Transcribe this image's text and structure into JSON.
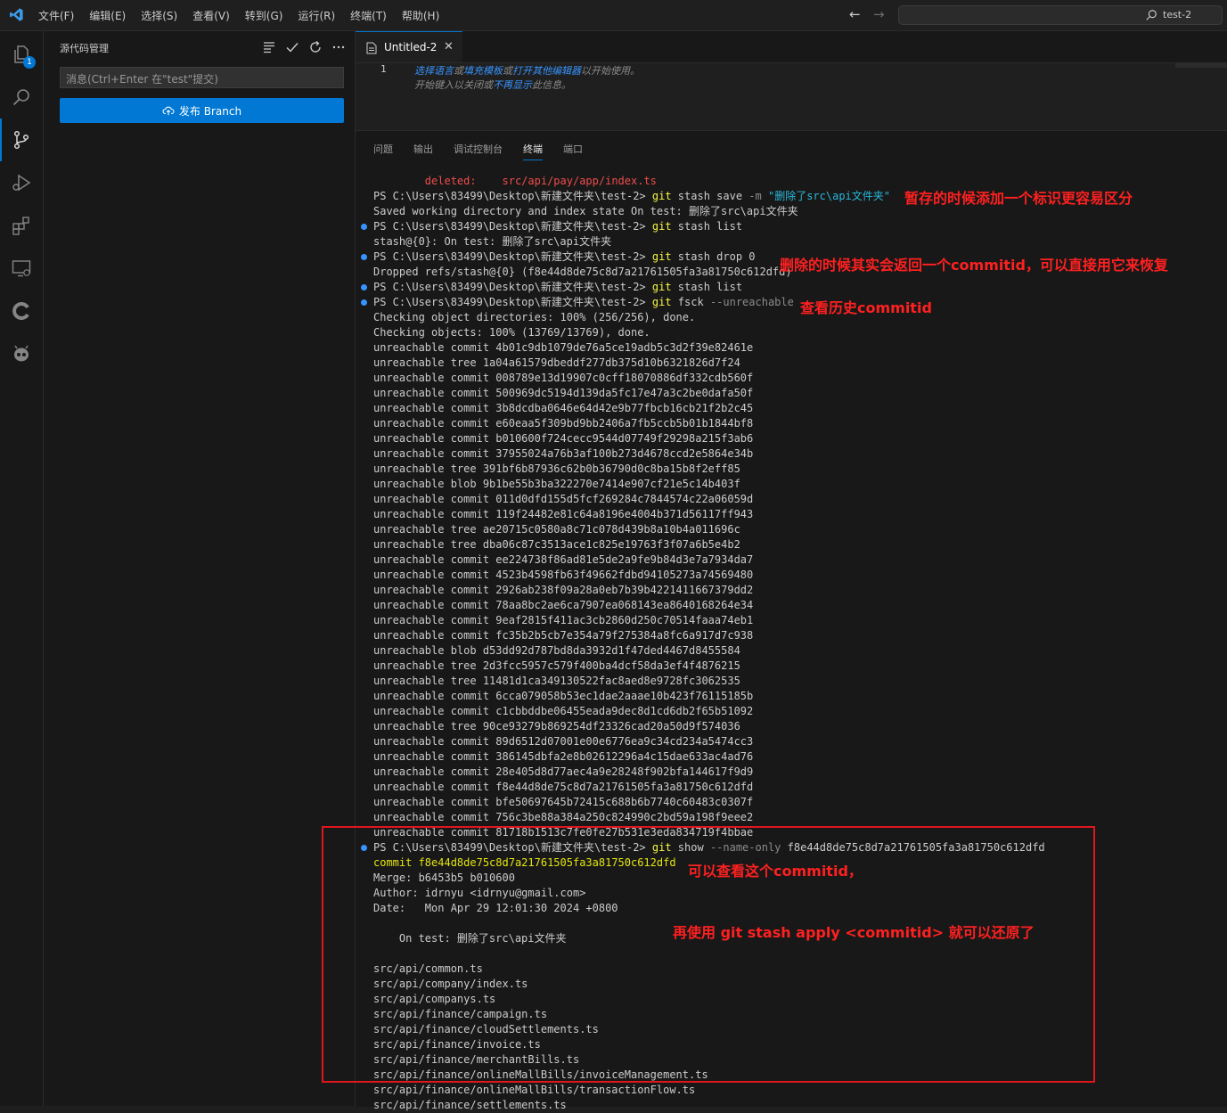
{
  "titlebar": {
    "menu": [
      "文件(F)",
      "编辑(E)",
      "选择(S)",
      "查看(V)",
      "转到(G)",
      "运行(R)",
      "终端(T)",
      "帮助(H)"
    ],
    "search_text": "test-2"
  },
  "activity": {
    "explorer_badge": "1"
  },
  "sidebar": {
    "title": "源代码管理",
    "message_placeholder": "消息(Ctrl+Enter 在\"test\"提交)",
    "publish_label": "发布 Branch"
  },
  "editor": {
    "tab_label": "Untitled-2",
    "line_number": "1",
    "hint1": {
      "a": "选择语言",
      "b": "或",
      "c": "填充模板",
      "d": "或",
      "e": "打开其他编辑器",
      "f": "以开始使用。"
    },
    "hint2": {
      "a": "开始键入以关闭或",
      "b": "不再显示",
      "c": "此信息。"
    }
  },
  "panel": {
    "tabs": [
      "问题",
      "输出",
      "调试控制台",
      "终端",
      "端口"
    ],
    "active_tab": "终端"
  },
  "terminal": {
    "deleted_label": "deleted:",
    "deleted_path": "src/api/pay/app/index.ts",
    "prompt": "PS C:\\Users\\83499\\Desktop\\新建文件夹\\test-2>",
    "cmd_stash_save_git": "git",
    "cmd_stash_save_rest": "stash save",
    "cmd_stash_save_flag": "-m",
    "cmd_stash_save_msg": "\"删除了src\\api文件夹\"",
    "saved_line": "Saved working directory and index state On test: 删除了src\\api文件夹",
    "cmd_list_git": "git",
    "cmd_list_rest": "stash list",
    "list_output": "stash@{0}: On test: 删除了src\\api文件夹",
    "cmd_drop_git": "git",
    "cmd_drop_rest": "stash drop 0",
    "dropped_line": "Dropped refs/stash@{0} (f8e44d8de75c8d7a21761505fa3a81750c612dfd)",
    "cmd_list2_git": "git",
    "cmd_list2_rest": "stash list",
    "cmd_fsck_git": "git",
    "cmd_fsck_rest": "fsck",
    "cmd_fsck_flag": "--unreachable",
    "check_dirs": "Checking object directories: 100% (256/256), done.",
    "check_objs": "Checking objects: 100% (13769/13769), done.",
    "unreachable": [
      "unreachable commit 4b01c9db1079de76a5ce19adb5c3d2f39e82461e",
      "unreachable tree 1a04a61579dbeddf277db375d10b6321826d7f24",
      "unreachable commit 008789e13d19907c0cff18070886df332cdb560f",
      "unreachable commit 500969dc5194d139da5fc17e47a3c2be0dafa50f",
      "unreachable commit 3b8dcdba0646e64d42e9b77fbcb16cb21f2b2c45",
      "unreachable commit e60eaa5f309bd9bb2406a7fb5ccb5b01b1844bf8",
      "unreachable commit b010600f724cecc9544d07749f29298a215f3ab6",
      "unreachable commit 37955024a76b3af100b273d4678ccd2e5864e34b",
      "unreachable tree 391bf6b87936c62b0b36790d0c8ba15b8f2eff85",
      "unreachable blob 9b1be55b3ba322270e7414e907cf21e5c14b403f",
      "unreachable commit 011d0dfd155d5fcf269284c7844574c22a06059d",
      "unreachable commit 119f24482e81c64a8196e4004b371d56117ff943",
      "unreachable tree ae20715c0580a8c71c078d439b8a10b4a011696c",
      "unreachable tree dba06c87c3513ace1c825e19763f3f07a6b5e4b2",
      "unreachable commit ee224738f86ad81e5de2a9fe9b84d3e7a7934da7",
      "unreachable commit 4523b4598fb63f49662fdbd94105273a74569480",
      "unreachable commit 2926ab238f09a28a0eb7b39b4221411667379dd2",
      "unreachable commit 78aa8bc2ae6ca7907ea068143ea8640168264e34",
      "unreachable commit 9eaf2815f411ac3cb2860d250c70514faaa74eb1",
      "unreachable commit fc35b2b5cb7e354a79f275384a8fc6a917d7c938",
      "unreachable blob d53dd92d787bd8da3932d1f47ded4467d8455584",
      "unreachable tree 2d3fcc5957c579f400ba4dcf58da3ef4f4876215",
      "unreachable tree 11481d1ca349130522fac8aed8e9728fc3062535",
      "unreachable commit 6cca079058b53ec1dae2aaae10b423f76115185b",
      "unreachable commit c1cbbddbe06455eada9dec8d1cd6db2f65b51092",
      "unreachable tree 90ce93279b869254df23326cad20a50d9f574036",
      "unreachable commit 89d6512d07001e00e6776ea9c34cd234a5474cc3",
      "unreachable commit 386145dbfa2e8b02612296a4c15dae633ac4ad76",
      "unreachable commit 28e405d8d77aec4a9e28248f902bfa144617f9d9",
      "unreachable commit f8e44d8de75c8d7a21761505fa3a81750c612dfd",
      "unreachable commit bfe50697645b72415c688b6b7740c60483c0307f",
      "unreachable commit 756c3be88a384a250c824990c2bd59a198f9eee2",
      "unreachable commit 81718b1513c7fe0fe27b531e3eda834719f4bbae"
    ],
    "cmd_show_git": "git",
    "cmd_show_rest": "show",
    "cmd_show_flag": "--name-only",
    "cmd_show_hash": "f8e44d8de75c8d7a21761505fa3a81750c612dfd",
    "commit_line": "commit f8e44d8de75c8d7a21761505fa3a81750c612dfd",
    "merge_line": "Merge: b6453b5 b010600",
    "author_line": "Author: idrnyu <idrnyu@gmail.com>",
    "date_line": "Date:   Mon Apr 29 12:01:30 2024 +0800",
    "message_line": "    On test: 删除了src\\api文件夹",
    "files": [
      "src/api/common.ts",
      "src/api/company/index.ts",
      "src/api/companys.ts",
      "src/api/finance/campaign.ts",
      "src/api/finance/cloudSettlements.ts",
      "src/api/finance/invoice.ts",
      "src/api/finance/merchantBills.ts",
      "src/api/finance/onlineMallBills/invoiceManagement.ts",
      "src/api/finance/onlineMallBills/transactionFlow.ts",
      "src/api/finance/settlements.ts"
    ]
  },
  "annotations": {
    "a1": "暂存的时候添加一个标识更容易区分",
    "a2": "删除的时候其实会返回一个commitid，可以直接用它来恢复",
    "a3": "查看历史commitid",
    "a4": "可以查看这个commitid，",
    "a5": "再使用 git stash apply <commitid> 就可以还原了"
  },
  "colors": {
    "accent": "#0078d4",
    "annotation_red": "#ff2020",
    "terminal_yellow": "#e5e510",
    "terminal_red": "#f14c4c"
  }
}
